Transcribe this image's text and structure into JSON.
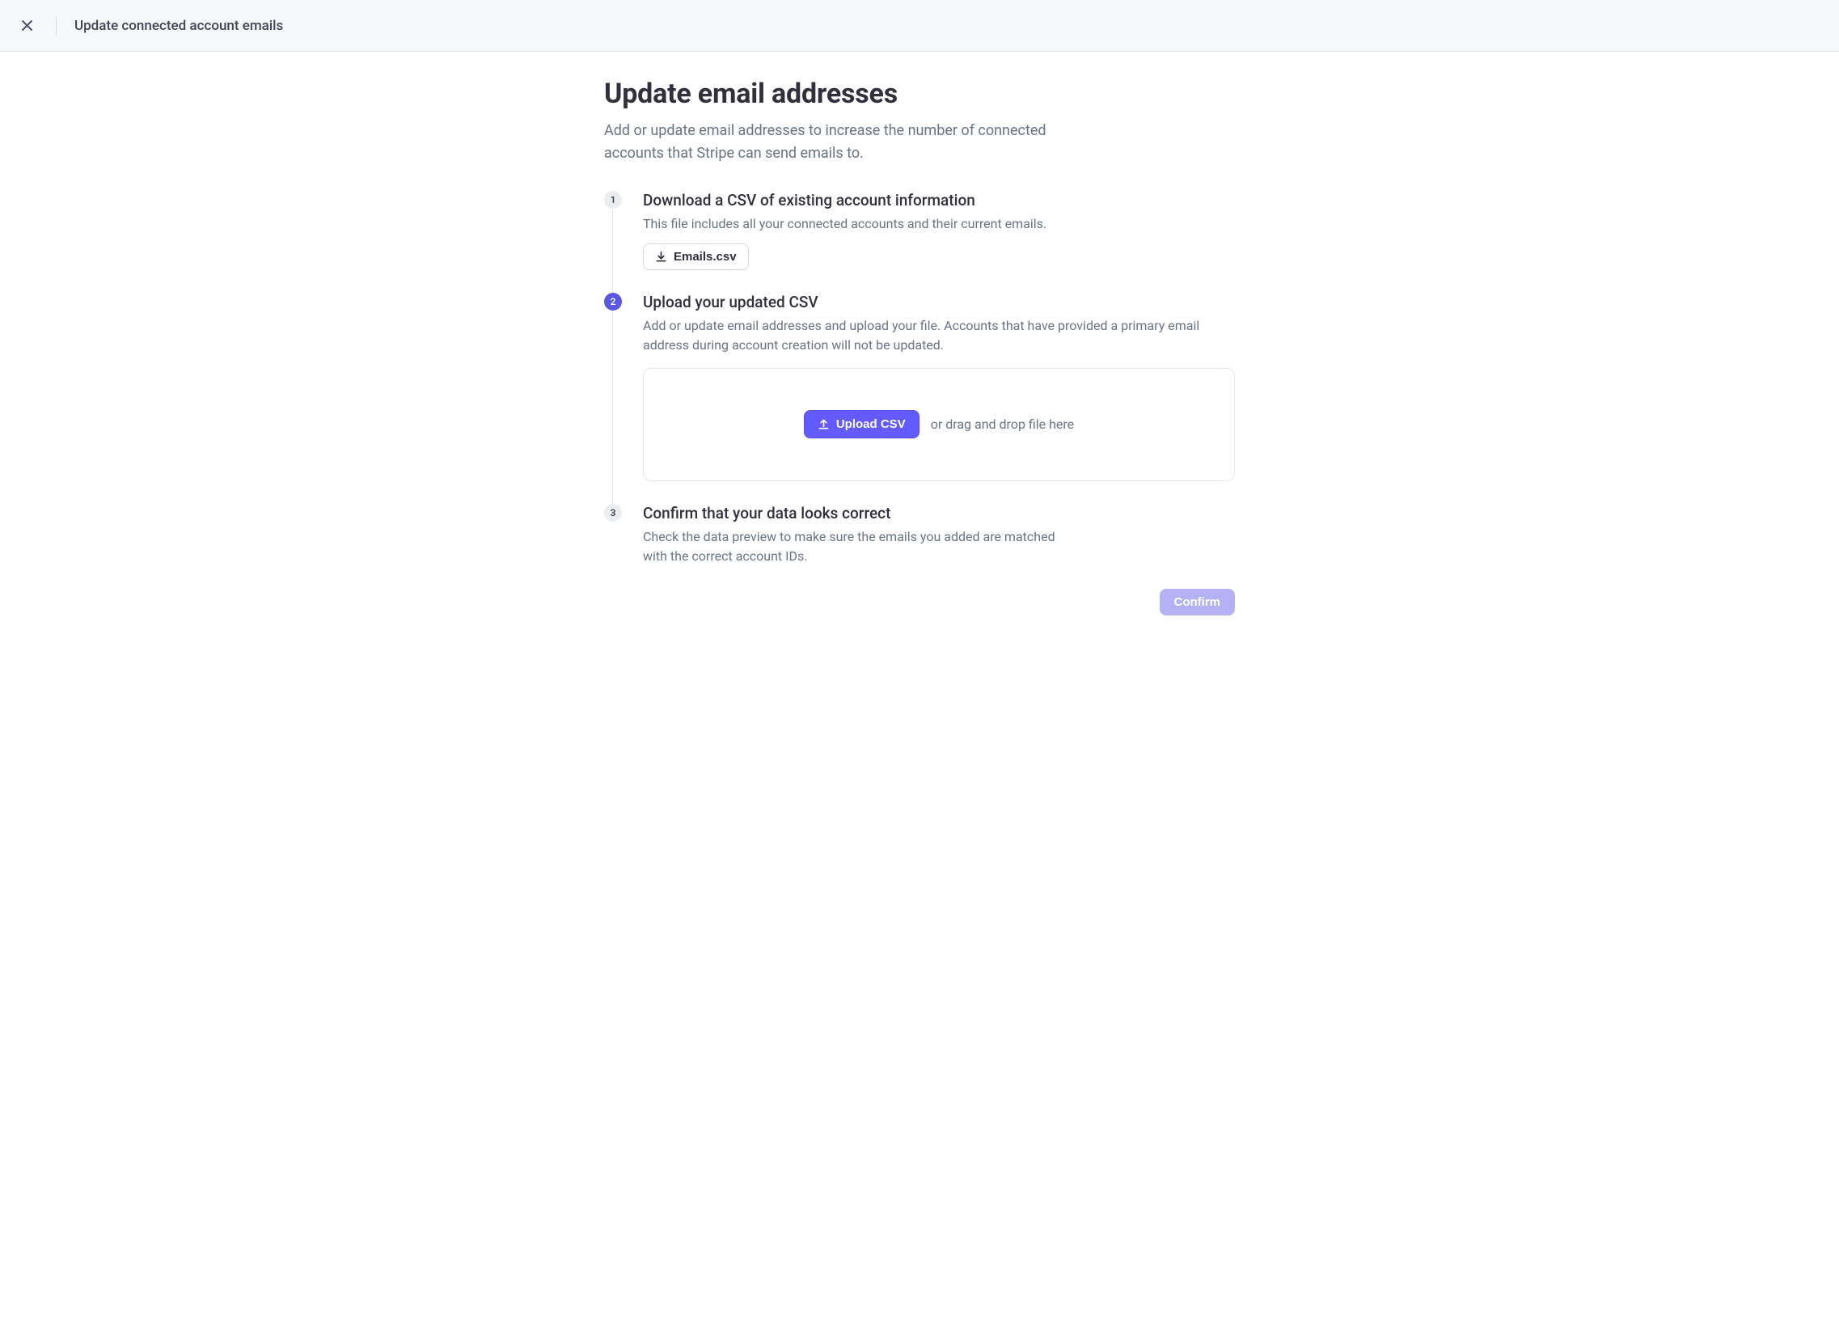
{
  "header": {
    "title": "Update connected account emails"
  },
  "page": {
    "title": "Update email addresses",
    "subtitle": "Add or update email addresses to increase the number of connected accounts that Stripe can send emails to."
  },
  "steps": [
    {
      "number": "1",
      "title": "Download a CSV of existing account information",
      "description": "This file includes all your connected accounts and their current emails.",
      "download_label": "Emails.csv"
    },
    {
      "number": "2",
      "title": "Upload your updated CSV",
      "description": "Add or update email addresses and upload your file. Accounts that have provided a primary email address during account creation will not be updated.",
      "upload_label": "Upload CSV",
      "drop_hint": "or drag and drop file here"
    },
    {
      "number": "3",
      "title": "Confirm that your data looks correct",
      "description": "Check the data preview to make sure the emails you added are matched with the correct account IDs."
    }
  ],
  "actions": {
    "confirm_label": "Confirm"
  },
  "colors": {
    "accent": "#635bff",
    "badge_active": "#5b57e0",
    "confirm_disabled": "#b4b1f4"
  }
}
